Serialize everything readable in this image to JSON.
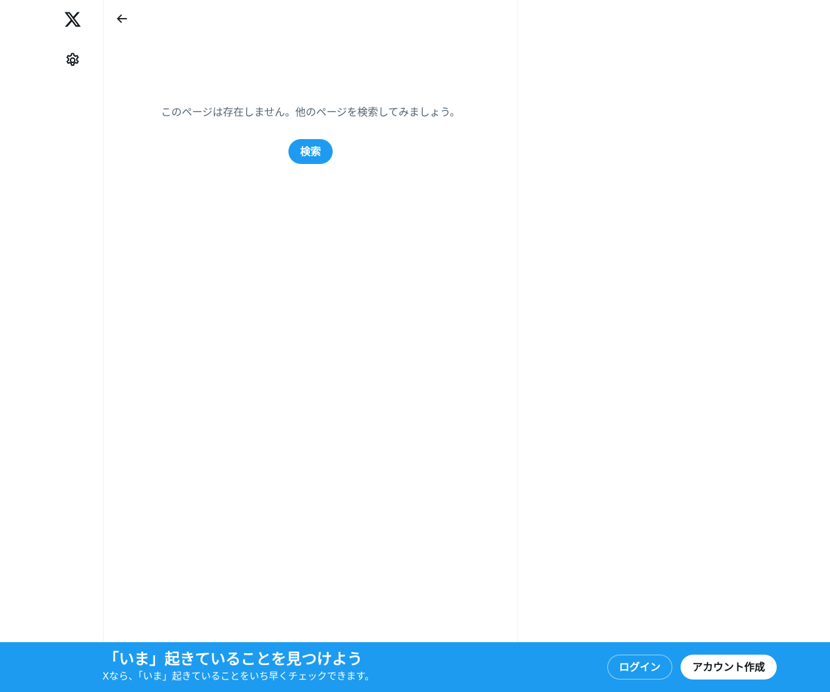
{
  "nav": {
    "logo_icon": "x-logo-icon",
    "settings_icon": "gear-icon"
  },
  "header": {
    "back_icon": "arrow-left-icon"
  },
  "main": {
    "empty_message": "このページは存在しません。他のページを検索してみましょう。",
    "search_button_label": "検索"
  },
  "bottom_bar": {
    "title": "「いま」起きていることを見つけよう",
    "subtitle": "Xなら、「いま」起きていることをいち早くチェックできます。",
    "login_label": "ログイン",
    "signup_label": "アカウント作成"
  },
  "colors": {
    "accent": "#1d9bf0",
    "text_primary": "#0f1419",
    "text_secondary": "#536471",
    "border": "#eff3f4"
  }
}
